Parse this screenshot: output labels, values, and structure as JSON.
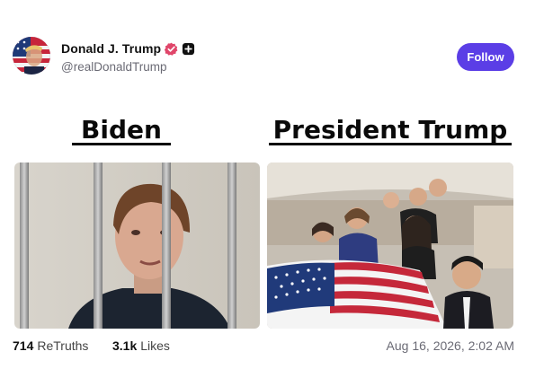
{
  "author": {
    "display_name": "Donald J. Trump",
    "handle": "@realDonaldTrump",
    "verified_icon": "verified-badge-icon",
    "plus_icon": "plus-badge-icon",
    "colors": {
      "verified": "#e0466a",
      "plus": "#111111"
    }
  },
  "actions": {
    "follow_label": "Follow",
    "follow_color": "#5b3ee6"
  },
  "meme": {
    "left_title": "Biden",
    "right_title": "President Trump"
  },
  "stats": {
    "retruths_count": "714",
    "retruths_label": "ReTruths",
    "likes_count": "3.1k",
    "likes_label": "Likes"
  },
  "timestamp": "Aug 16, 2026, 2:02 AM"
}
